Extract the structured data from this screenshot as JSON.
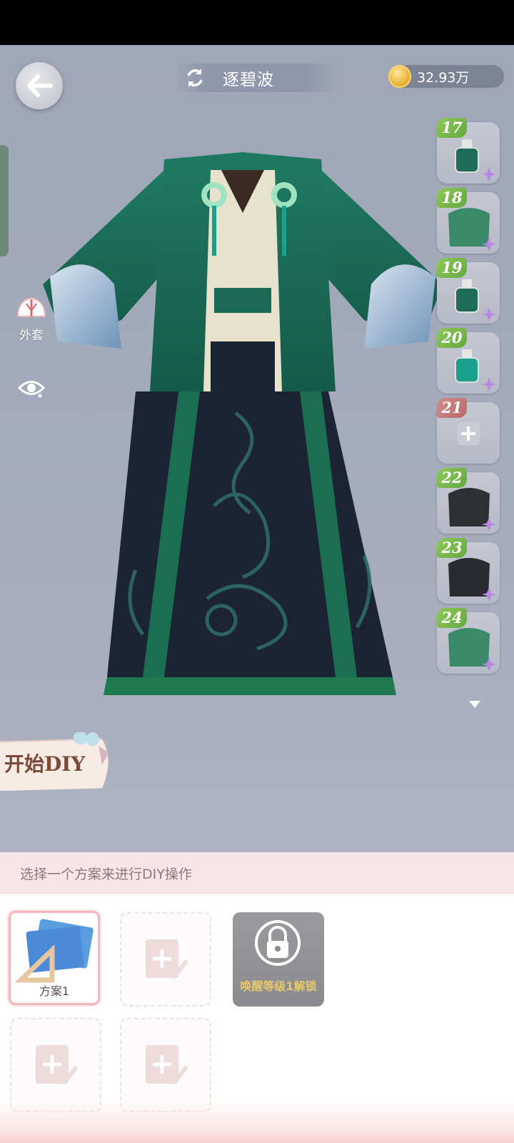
{
  "header": {
    "back_label": "back",
    "outfit_name": "逐碧波",
    "coins": "32.93万"
  },
  "side_tools": {
    "coat_label": "外套"
  },
  "items": [
    {
      "num": "17",
      "type": "bottle",
      "color": "#1f6b5a"
    },
    {
      "num": "18",
      "type": "cloth",
      "color": "#3a8a6a"
    },
    {
      "num": "19",
      "type": "bottle",
      "color": "#1f6b5a"
    },
    {
      "num": "20",
      "type": "bottle",
      "color": "#1aa08c"
    },
    {
      "num": "21",
      "type": "empty",
      "color": "#b0b4c0"
    },
    {
      "num": "22",
      "type": "cloth",
      "color": "#2e2f33"
    },
    {
      "num": "23",
      "type": "cloth",
      "color": "#2a2b30"
    },
    {
      "num": "24",
      "type": "cloth",
      "color": "#3a8a6a"
    }
  ],
  "diy": {
    "button_label": "开始DIY"
  },
  "panel": {
    "hint": "选择一个方案来进行DIY操作",
    "plans": [
      {
        "name": "方案1",
        "state": "selected"
      },
      {
        "name": "",
        "state": "empty"
      },
      {
        "name": "",
        "state": "locked",
        "lock_text": "唤醒等级1解锁"
      },
      {
        "name": "",
        "state": "empty"
      },
      {
        "name": "",
        "state": "empty"
      }
    ]
  },
  "colors": {
    "accent_green": "#1e6b55",
    "panel_header_bg": "#f7e6e7",
    "selected_border": "#f3b7bb"
  }
}
